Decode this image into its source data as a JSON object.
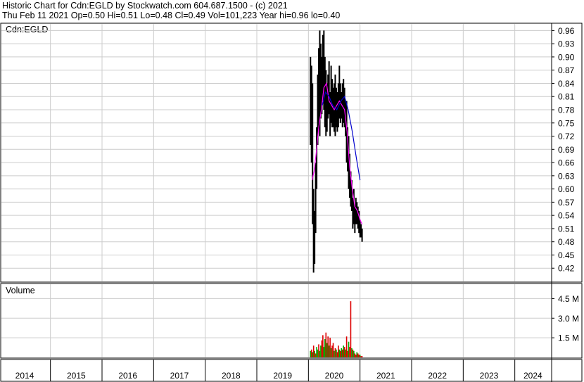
{
  "header": {
    "title": "Historic Chart for Cdn:EGLD by Stockwatch.com 604.687.1500 - (c) 2021",
    "quote": "Thu Feb 11 2021  Op=0.50  Hi=0.51  Lo=0.48  Cl=0.49  Vol=101,223  Year hi=0.96  lo=0.40"
  },
  "colors": {
    "price_bar": "#000000",
    "ma_short": "#ff00ff",
    "ma_long": "#0000cc",
    "volume_up": "#00aa00",
    "volume_down": "#dd0000",
    "grid": "#cccccc"
  },
  "chart_data": [
    {
      "type": "line",
      "title": "Cdn:EGLD",
      "ylim": [
        0.39,
        0.975
      ],
      "y_ticks": [
        "0.96",
        "0.93",
        "0.90",
        "0.87",
        "0.84",
        "0.81",
        "0.78",
        "0.75",
        "0.72",
        "0.69",
        "0.66",
        "0.63",
        "0.60",
        "0.57",
        "0.54",
        "0.51",
        "0.48",
        "0.45",
        "0.42"
      ],
      "x_ticks": [
        "2014",
        "2015",
        "2016",
        "2017",
        "2018",
        "2019",
        "2020",
        "2021",
        "2022",
        "2023",
        "2024"
      ],
      "x_range": [
        2013.7,
        2024.35
      ],
      "grid": true,
      "series": [
        {
          "kind": "hilo",
          "x": [
            2019.69,
            2019.71,
            2019.73,
            2019.75,
            2019.77,
            2019.79,
            2019.81,
            2019.83,
            2019.85,
            2019.87,
            2019.89,
            2019.91,
            2019.93,
            2019.95,
            2019.97,
            2019.99,
            2020.01,
            2020.03,
            2020.05,
            2020.07,
            2020.09,
            2020.11,
            2020.13,
            2020.15,
            2020.17,
            2020.19,
            2020.21,
            2020.23,
            2020.25,
            2020.27,
            2020.29,
            2020.31,
            2020.33,
            2020.35,
            2020.37,
            2020.39,
            2020.41,
            2020.43,
            2020.45,
            2020.47,
            2020.49,
            2020.51,
            2020.53,
            2020.55,
            2020.57,
            2020.59,
            2020.61,
            2020.63,
            2020.65,
            2020.67,
            2020.69
          ],
          "high": [
            0.9,
            0.88,
            0.84,
            0.6,
            0.55,
            0.66,
            0.74,
            0.86,
            0.92,
            0.96,
            0.93,
            0.9,
            0.95,
            0.96,
            0.9,
            0.87,
            0.84,
            0.86,
            0.89,
            0.82,
            0.88,
            0.85,
            0.83,
            0.84,
            0.86,
            0.83,
            0.82,
            0.84,
            0.88,
            0.84,
            0.82,
            0.84,
            0.85,
            0.83,
            0.8,
            0.8,
            0.74,
            0.72,
            0.68,
            0.64,
            0.62,
            0.58,
            0.6,
            0.56,
            0.58,
            0.57,
            0.56,
            0.55,
            0.53,
            0.52,
            0.51
          ],
          "low": [
            0.7,
            0.66,
            0.52,
            0.41,
            0.43,
            0.5,
            0.6,
            0.7,
            0.74,
            0.72,
            0.76,
            0.77,
            0.8,
            0.78,
            0.74,
            0.72,
            0.73,
            0.76,
            0.77,
            0.72,
            0.75,
            0.74,
            0.74,
            0.73,
            0.72,
            0.74,
            0.73,
            0.74,
            0.76,
            0.75,
            0.76,
            0.74,
            0.75,
            0.74,
            0.72,
            0.66,
            0.64,
            0.6,
            0.58,
            0.56,
            0.55,
            0.51,
            0.52,
            0.5,
            0.52,
            0.52,
            0.51,
            0.5,
            0.49,
            0.49,
            0.48
          ]
        },
        {
          "name": "",
          "kind": "ma",
          "color": "ma_short",
          "x": [
            2019.72,
            2019.76,
            2019.8,
            2019.85,
            2019.9,
            2019.95,
            2020.0,
            2020.05,
            2020.1,
            2020.15,
            2020.2,
            2020.25,
            2020.3,
            2020.35,
            2020.4,
            2020.45,
            2020.5,
            2020.55,
            2020.6,
            2020.65,
            2020.69
          ],
          "y": [
            0.62,
            0.64,
            0.68,
            0.74,
            0.78,
            0.83,
            0.84,
            0.8,
            0.79,
            0.78,
            0.79,
            0.8,
            0.79,
            0.78,
            0.73,
            0.65,
            0.6,
            0.56,
            0.55,
            0.53,
            0.52
          ]
        },
        {
          "name": "",
          "kind": "ma",
          "color": "ma_long",
          "x": [
            2019.92,
            2019.98,
            2020.05,
            2020.12,
            2020.2,
            2020.28,
            2020.35,
            2020.42,
            2020.5,
            2020.58,
            2020.65
          ],
          "y": [
            0.79,
            0.82,
            0.81,
            0.79,
            0.78,
            0.8,
            0.81,
            0.78,
            0.73,
            0.67,
            0.62
          ]
        }
      ]
    },
    {
      "type": "bar",
      "title": "Volume",
      "ylim": [
        0,
        5.6
      ],
      "y_ticks": [
        "4.5 M",
        "3.0 M",
        "1.5 M"
      ],
      "y_tick_values": [
        4.5,
        3.0,
        1.5
      ],
      "x": [
        2019.69,
        2019.71,
        2019.73,
        2019.75,
        2019.77,
        2019.79,
        2019.81,
        2019.83,
        2019.85,
        2019.87,
        2019.89,
        2019.91,
        2019.93,
        2019.95,
        2019.97,
        2019.99,
        2020.01,
        2020.03,
        2020.05,
        2020.07,
        2020.09,
        2020.11,
        2020.13,
        2020.15,
        2020.17,
        2020.19,
        2020.21,
        2020.23,
        2020.25,
        2020.27,
        2020.29,
        2020.31,
        2020.33,
        2020.35,
        2020.37,
        2020.39,
        2020.41,
        2020.43,
        2020.45,
        2020.47,
        2020.49,
        2020.51,
        2020.53,
        2020.55,
        2020.57,
        2020.59,
        2020.61,
        2020.63,
        2020.65,
        2020.67,
        2020.69
      ],
      "values": [
        0.5,
        0.6,
        0.4,
        0.9,
        0.5,
        0.3,
        0.8,
        0.6,
        1.0,
        0.5,
        0.9,
        1.3,
        1.7,
        0.8,
        1.4,
        1.9,
        1.1,
        1.6,
        0.9,
        1.5,
        0.7,
        0.9,
        1.1,
        0.5,
        0.7,
        0.6,
        0.4,
        0.9,
        0.6,
        0.5,
        0.7,
        0.6,
        0.9,
        0.8,
        0.6,
        1.6,
        0.5,
        1.2,
        0.8,
        4.3,
        0.7,
        0.6,
        0.5,
        0.3,
        0.2,
        0.4,
        0.3,
        0.2,
        0.2,
        0.1,
        0.1
      ],
      "up": [
        true,
        false,
        true,
        false,
        true,
        false,
        true,
        true,
        false,
        true,
        true,
        false,
        false,
        true,
        true,
        false,
        true,
        false,
        true,
        false,
        true,
        false,
        false,
        true,
        false,
        true,
        false,
        false,
        true,
        false,
        true,
        false,
        true,
        false,
        true,
        false,
        false,
        true,
        false,
        false,
        true,
        false,
        true,
        false,
        false,
        true,
        false,
        false,
        true,
        false,
        false
      ]
    }
  ]
}
